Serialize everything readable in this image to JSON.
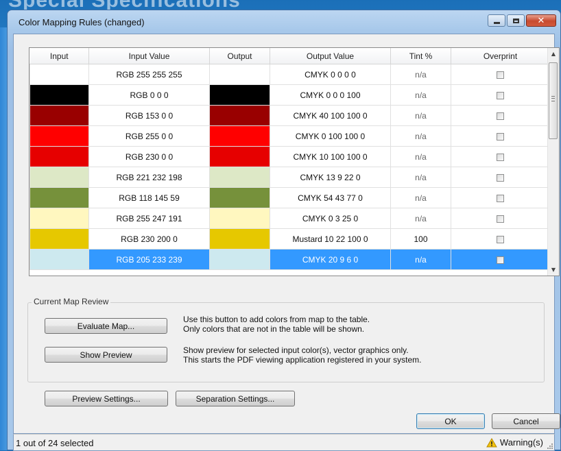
{
  "window": {
    "title": "Color Mapping Rules (changed)",
    "background_text": "Special Specifications"
  },
  "table": {
    "columns": [
      "Input",
      "Input Value",
      "Output",
      "Output Value",
      "Tint %",
      "Overprint"
    ],
    "rows": [
      {
        "input_color": "#ffffff",
        "input_value": "RGB 255 255 255",
        "output_color": "#ffffff",
        "output_value": "CMYK 0 0 0 0",
        "tint": "n/a",
        "overprint": false,
        "selected": false
      },
      {
        "input_color": "#000000",
        "input_value": "RGB 0 0 0",
        "output_color": "#000000",
        "output_value": "CMYK 0 0 0 100",
        "tint": "n/a",
        "overprint": false,
        "selected": false
      },
      {
        "input_color": "#990000",
        "input_value": "RGB 153 0 0",
        "output_color": "#990000",
        "output_value": "CMYK 40 100 100 0",
        "tint": "n/a",
        "overprint": false,
        "selected": false
      },
      {
        "input_color": "#ff0000",
        "input_value": "RGB 255 0 0",
        "output_color": "#ff0000",
        "output_value": "CMYK 0 100 100 0",
        "tint": "n/a",
        "overprint": false,
        "selected": false
      },
      {
        "input_color": "#e60000",
        "input_value": "RGB 230 0 0",
        "output_color": "#e60000",
        "output_value": "CMYK 10 100 100 0",
        "tint": "n/a",
        "overprint": false,
        "selected": false
      },
      {
        "input_color": "#dde8c6",
        "input_value": "RGB 221 232 198",
        "output_color": "#dde8c6",
        "output_value": "CMYK 13 9 22 0",
        "tint": "n/a",
        "overprint": false,
        "selected": false
      },
      {
        "input_color": "#76913b",
        "input_value": "RGB 118 145 59",
        "output_color": "#76913b",
        "output_value": "CMYK 54 43 77 0",
        "tint": "n/a",
        "overprint": false,
        "selected": false
      },
      {
        "input_color": "#fff7bf",
        "input_value": "RGB 255 247 191",
        "output_color": "#fff7bf",
        "output_value": "CMYK 0 3 25 0",
        "tint": "n/a",
        "overprint": false,
        "selected": false
      },
      {
        "input_color": "#e6c800",
        "input_value": "RGB 230 200 0",
        "output_color": "#e6c800",
        "output_value": "Mustard 10 22 100 0",
        "tint": "100",
        "overprint": false,
        "selected": false
      },
      {
        "input_color": "#cde9ef",
        "input_value": "RGB 205 233 239",
        "output_color": "#cde9ef",
        "output_value": "CMYK 20 9 6 0",
        "tint": "n/a",
        "overprint": false,
        "selected": true
      }
    ]
  },
  "map_review": {
    "legend": "Current Map Review",
    "evaluate_button": "Evaluate Map...",
    "evaluate_desc_line1": "Use this button to add colors from map to the table.",
    "evaluate_desc_line2": "Only colors that are not in the table will be shown.",
    "preview_button": "Show Preview",
    "preview_desc_line1": "Show preview for selected input color(s), vector graphics only.",
    "preview_desc_line2": "This starts the PDF viewing application registered in your system."
  },
  "footer": {
    "preview_settings": "Preview Settings...",
    "separation_settings": "Separation Settings...",
    "ok": "OK",
    "cancel": "Cancel"
  },
  "status": {
    "selection": "1 out of 24 selected",
    "warning": "Warning(s)",
    "warning_icon": "warning-triangle-icon"
  },
  "colors": {
    "selection": "#3399ff",
    "title_bar": "#a7c8ea"
  }
}
